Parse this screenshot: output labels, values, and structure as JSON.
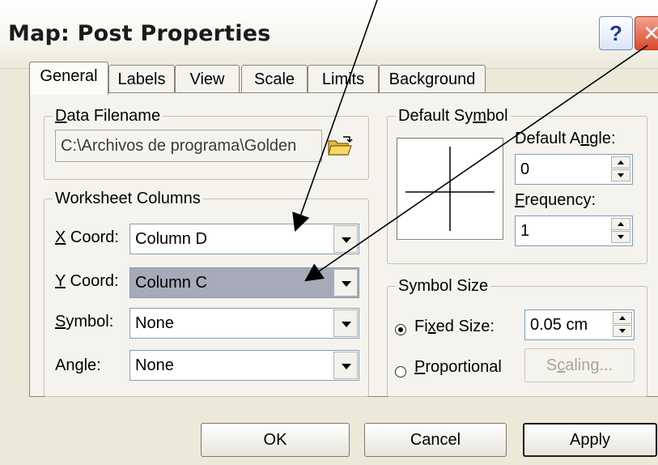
{
  "window": {
    "title": "Map: Post Properties",
    "help_glyph": "?",
    "close_glyph": "✕"
  },
  "tabs": [
    {
      "label": "General",
      "active": true
    },
    {
      "label": "Labels",
      "active": false
    },
    {
      "label": "View",
      "active": false
    },
    {
      "label": "Scale",
      "active": false
    },
    {
      "label": "Limits",
      "active": false
    },
    {
      "label": "Background",
      "active": false
    }
  ],
  "data_filename": {
    "legend_pre": "",
    "legend_u": "D",
    "legend_post": "ata Filename",
    "value": "C:\\Archivos de programa\\Golden",
    "browse_icon": "folder-open-icon"
  },
  "worksheet_columns": {
    "legend": "Worksheet Columns",
    "x_coord": {
      "label_u": "X",
      "label_post": " Coord:",
      "value": "Column D"
    },
    "y_coord": {
      "label_u": "Y",
      "label_post": " Coord:",
      "value": "Column C"
    },
    "symbol": {
      "label_u": "S",
      "label_post": "ymbol:",
      "value": "None"
    },
    "angle": {
      "label": "Angle:",
      "value": "None"
    }
  },
  "default_symbol": {
    "legend_pre": "Default Sy",
    "legend_u": "m",
    "legend_post": "bol",
    "angle_label_pre": "Default A",
    "angle_label_u": "n",
    "angle_label_post": "gle:",
    "angle_value": "0",
    "frequency_label_u": "F",
    "frequency_label_post": "requency:",
    "frequency_value": "1"
  },
  "symbol_size": {
    "legend": "Symbol Size",
    "fixed_pre": "Fi",
    "fixed_u": "x",
    "fixed_post": "ed Size:",
    "fixed_value": "0.05 cm",
    "fixed_selected": true,
    "proportional_u": "P",
    "proportional_post": "roportional",
    "scaling_pre": "S",
    "scaling_u": "c",
    "scaling_post": "aling..."
  },
  "buttons": {
    "ok": "OK",
    "cancel": "Cancel",
    "apply": "Apply"
  },
  "colors": {
    "dialog_bg": "#ece9d8",
    "panel_bg": "#f4f3ee",
    "selected_combo": "#a7aab8",
    "border": "#7f9db9"
  }
}
